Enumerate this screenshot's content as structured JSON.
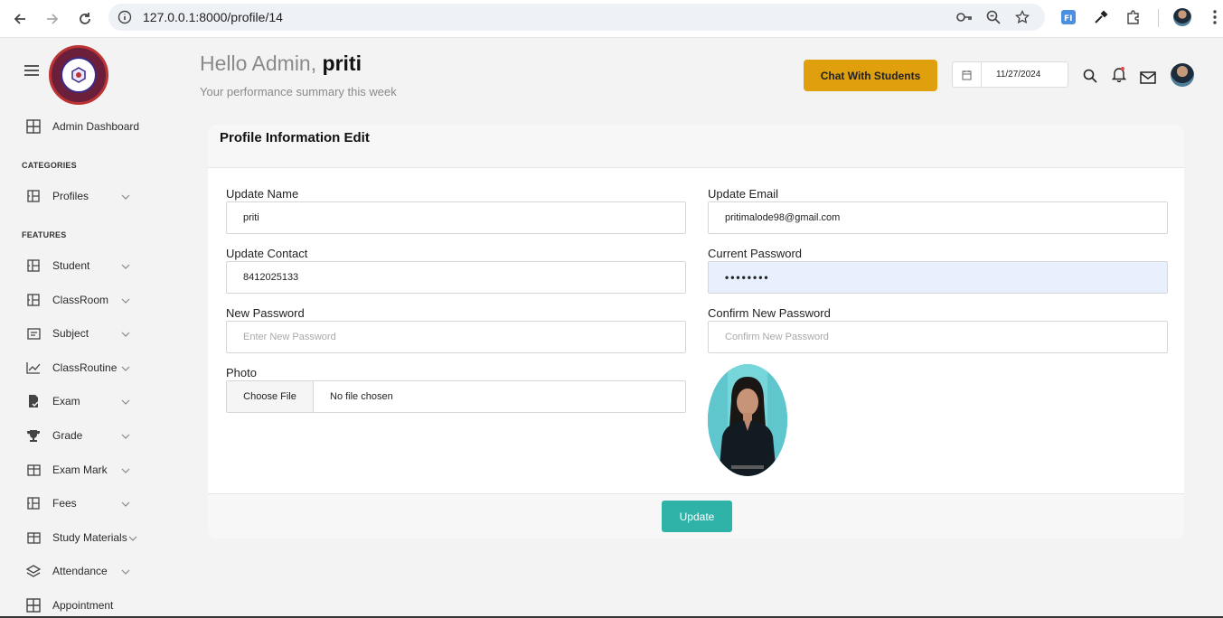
{
  "browser": {
    "url": "127.0.0.1:8000/profile/14"
  },
  "sidebar": {
    "dashboard_label": "Admin Dashboard",
    "categories_title": "CATEGORIES",
    "features_title": "FEATURES",
    "items": [
      {
        "label": "Profiles",
        "icon": "layout-icon"
      },
      {
        "label": "Student",
        "icon": "layout-icon"
      },
      {
        "label": "ClassRoom",
        "icon": "layout-icon"
      },
      {
        "label": "Subject",
        "icon": "message-square-icon"
      },
      {
        "label": "ClassRoutine",
        "icon": "line-chart-icon"
      },
      {
        "label": "Exam",
        "icon": "file-check-icon"
      },
      {
        "label": "Grade",
        "icon": "trophy-icon"
      },
      {
        "label": "Exam Mark",
        "icon": "table-icon"
      },
      {
        "label": "Fees",
        "icon": "layout-icon"
      },
      {
        "label": "Study Materials",
        "icon": "table-icon"
      },
      {
        "label": "Attendance",
        "icon": "layers-icon"
      },
      {
        "label": "Appointment",
        "icon": "grid-icon"
      }
    ]
  },
  "header": {
    "greeting_prefix": "Hello Admin,",
    "greeting_name": "priti",
    "subtitle": "Your performance summary this week",
    "chat_button": "Chat With Students",
    "date_value": "11/27/2024"
  },
  "card": {
    "title": "Profile Information Edit",
    "name_label": "Update Name",
    "name_value": "priti",
    "email_label": "Update Email",
    "email_value": "pritimalode98@gmail.com",
    "contact_label": "Update Contact",
    "contact_value": "8412025133",
    "current_password_label": "Current Password",
    "current_password_value": "••••••••",
    "new_password_label": "New Password",
    "new_password_placeholder": "Enter New Password",
    "confirm_password_label": "Confirm New Password",
    "confirm_password_placeholder": "Confirm New Password",
    "photo_label": "Photo",
    "file_button": "Choose File",
    "file_status": "No file chosen",
    "update_button": "Update"
  },
  "colors": {
    "accent_orange": "#e0a00e",
    "accent_teal": "#2fb3a9",
    "autofill_blue": "#e8f0fe"
  }
}
